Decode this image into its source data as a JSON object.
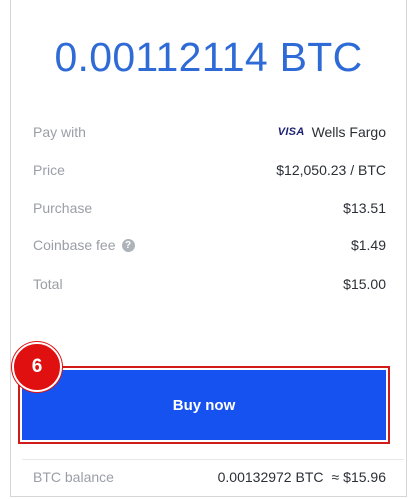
{
  "colors": {
    "accent": "#2f6bd6",
    "button_bg": "#1652f0",
    "highlight_red": "#e01010",
    "label_gray": "#9a9ea6",
    "value_dark": "#2b2f36"
  },
  "order": {
    "amount": "0.00112114 BTC"
  },
  "details": {
    "pay_with": {
      "label": "Pay with",
      "card_brand": "VISA",
      "value": "Wells Fargo"
    },
    "price": {
      "label": "Price",
      "value": "$12,050.23 / BTC"
    },
    "purchase": {
      "label": "Purchase",
      "value": "$13.51"
    },
    "fee": {
      "label": "Coinbase fee",
      "icon": "info-icon",
      "value": "$1.49"
    },
    "total": {
      "label": "Total",
      "value": "$15.00"
    }
  },
  "annotation": {
    "step_number": "6"
  },
  "action": {
    "buy_label": "Buy now"
  },
  "balance": {
    "label": "BTC balance",
    "btc": "0.00132972 BTC",
    "approx_symbol": "≈",
    "usd": "$15.96"
  }
}
